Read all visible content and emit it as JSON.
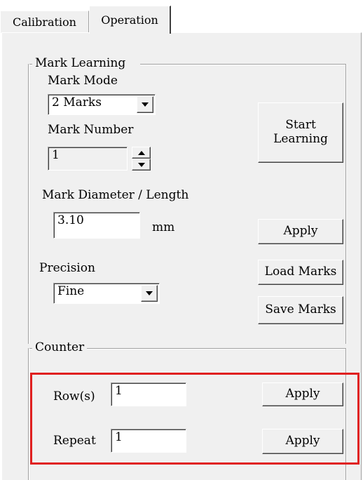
{
  "tabs": [
    {
      "label": "Calibration",
      "active": false
    },
    {
      "label": "Operation",
      "active": true
    }
  ],
  "mark_learning": {
    "title": "Mark Learning",
    "mark_mode_label": "Mark Mode",
    "mark_mode_value": "2 Marks",
    "mark_number_label": "Mark Number",
    "mark_number_value": "1",
    "start_learning_label": "Start\nLearning",
    "diameter_label": "Mark Diameter / Length",
    "diameter_value": "3.10",
    "diameter_unit": "mm",
    "apply_label": "Apply",
    "precision_label": "Precision",
    "precision_value": "Fine",
    "load_marks_label": "Load Marks",
    "save_marks_label": "Save Marks"
  },
  "counter": {
    "title": "Counter",
    "rows_label": "Row(s)",
    "rows_value": "1",
    "rows_apply_label": "Apply",
    "repeat_label": "Repeat",
    "repeat_value": "1",
    "repeat_apply_label": "Apply"
  },
  "colors": {
    "panel_bg": "#f0f0f0",
    "highlight": "#e02020"
  },
  "icons": [
    "chevron-down-icon",
    "chevron-up-icon"
  ]
}
